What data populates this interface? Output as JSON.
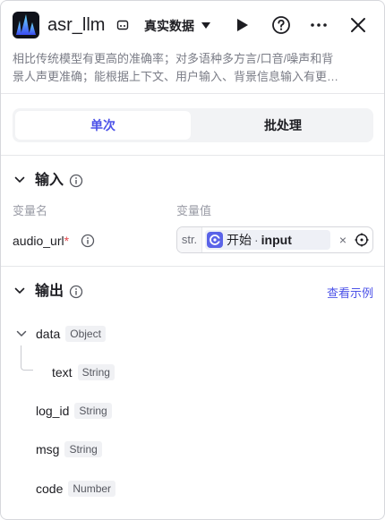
{
  "header": {
    "title": "asr_llm",
    "dataset_label": "真实数据",
    "icons": [
      "workflow-logo",
      "dataset-icon",
      "play-icon",
      "help-icon",
      "more-icon",
      "close-icon"
    ]
  },
  "description": {
    "line1": "相比传统模型有更高的准确率；对多语种多方言/口音/噪声和背",
    "line2": "景人声更准确；能根据上下文、用户输入、背景信息输入有更…"
  },
  "tabs": [
    {
      "label": "单次",
      "active": true
    },
    {
      "label": "批处理",
      "active": false
    }
  ],
  "input_section": {
    "title": "输入",
    "col_name": "变量名",
    "col_value": "变量值",
    "param": {
      "name": "audio_url",
      "required_mark": "*",
      "type_tag": "str.",
      "ref_node": "开始",
      "ref_separator": "·",
      "ref_var": "input",
      "clear": "×"
    }
  },
  "output_section": {
    "title": "输出",
    "view_example": "查看示例",
    "fields": [
      {
        "name": "data",
        "type": "Object"
      },
      {
        "name": "text",
        "type": "String"
      },
      {
        "name": "log_id",
        "type": "String"
      },
      {
        "name": "msg",
        "type": "String"
      },
      {
        "name": "code",
        "type": "Number"
      }
    ]
  },
  "colors": {
    "accent": "#4d53e8",
    "required": "#e5484d",
    "muted": "#7a7c86"
  }
}
